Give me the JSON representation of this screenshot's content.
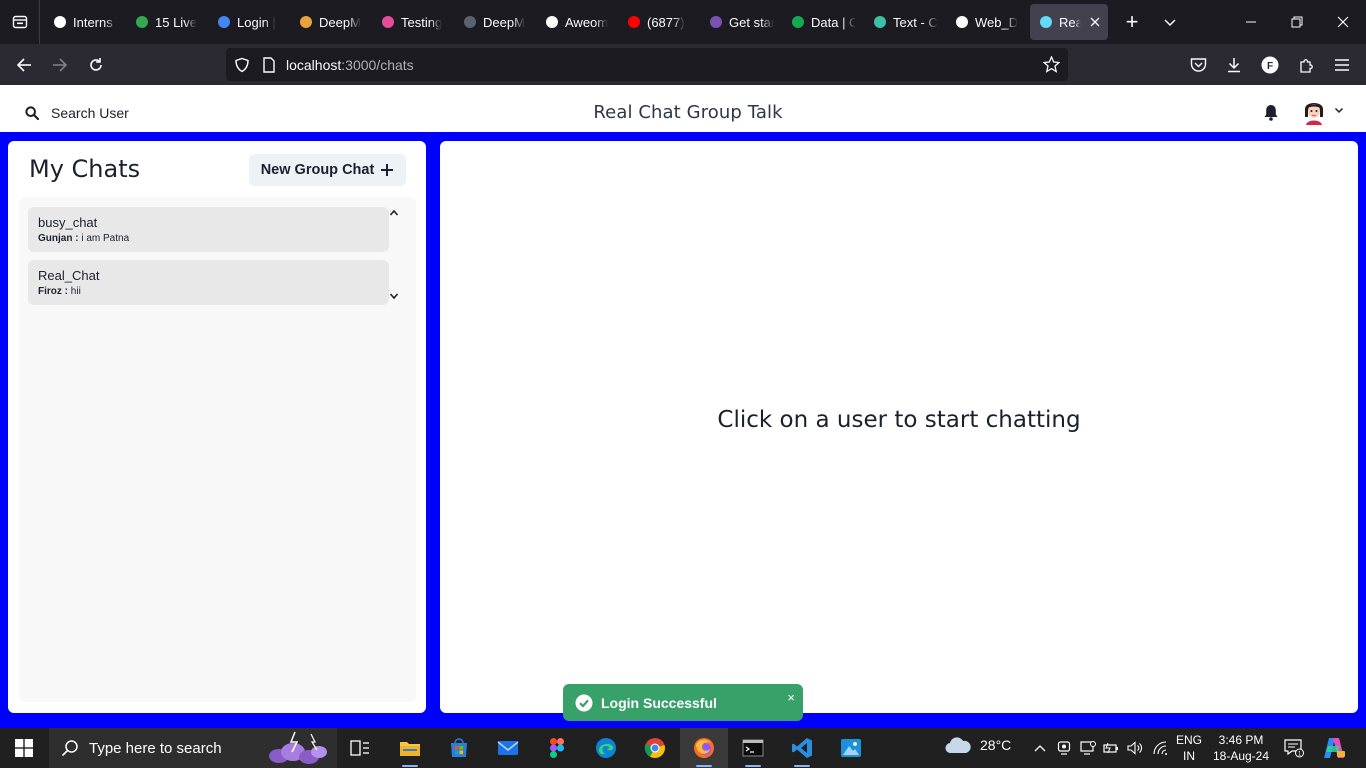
{
  "browser": {
    "tabs": [
      {
        "title": "Interns Task",
        "icon": "notion-icon",
        "color": "#ffffff"
      },
      {
        "title": "15 Live",
        "icon": "google-drive-icon",
        "color": "#34a853"
      },
      {
        "title": "Login |",
        "icon": "login-site-icon",
        "color": "#4285f4"
      },
      {
        "title": "DeepM",
        "icon": "deepmind-icon",
        "color": "#e8a33d"
      },
      {
        "title": "Testing",
        "icon": "testing-app-icon",
        "color": "#e74c9b"
      },
      {
        "title": "DeepM",
        "icon": "deepmind-dark-icon",
        "color": "#5a6270"
      },
      {
        "title": "Aweom",
        "icon": "github-icon",
        "color": "#ffffff"
      },
      {
        "title": "(6877)",
        "icon": "youtube-icon",
        "color": "#ff0000"
      },
      {
        "title": "Get star",
        "icon": "bootstrap-icon",
        "color": "#7952b3"
      },
      {
        "title": "Data | C",
        "icon": "mongodb-icon",
        "color": "#13aa52"
      },
      {
        "title": "Text - C",
        "icon": "chakra-icon",
        "color": "#3ebfa8"
      },
      {
        "title": "Web_D",
        "icon": "github-icon",
        "color": "#ffffff"
      },
      {
        "title": "Real",
        "icon": "react-icon",
        "color": "#61dafb"
      }
    ],
    "url_host": "localhost",
    "url_path": ":3000/chats"
  },
  "header": {
    "search_label": "Search User",
    "title": "Real Chat Group Talk"
  },
  "sidebar": {
    "title": "My Chats",
    "new_group_label": "New Group Chat",
    "chats": [
      {
        "name": "busy_chat",
        "sender": "Gunjan :",
        "message": "i am Patna"
      },
      {
        "name": "Real_Chat",
        "sender": "Firoz :",
        "message": "hii"
      }
    ]
  },
  "chatbox": {
    "empty_message": "Click on a user to start chatting"
  },
  "toast": {
    "message": "Login Successful",
    "close_symbol": "×",
    "color": "#38a169"
  },
  "taskbar": {
    "search_placeholder": "Type here to search",
    "temperature": "28°C",
    "lang_line1": "ENG",
    "lang_line2": "IN",
    "time": "3:46 PM",
    "date": "18-Aug-24"
  },
  "colors": {
    "page_background": "#0000ff",
    "panel": "#ffffff",
    "chat_item": "#e8e8e8"
  }
}
